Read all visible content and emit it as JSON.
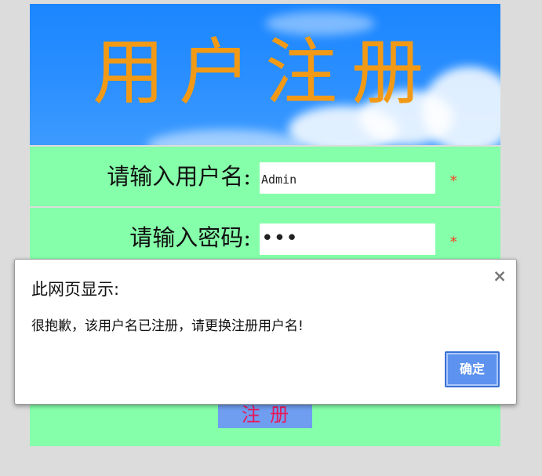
{
  "banner": {
    "title": "用户注册"
  },
  "form": {
    "username_label": "请输入用户名:",
    "username_value": "Admin",
    "password_label": "请输入密码:",
    "password_mask": "•••",
    "required_mark": "*",
    "submit_label": "注册"
  },
  "dialog": {
    "title": "此网页显示:",
    "close_symbol": "×",
    "message": "很抱歉，该用户名已注册，请更换注册用户名!",
    "ok_label": "确定"
  },
  "colors": {
    "banner_sky": "#1b86ff",
    "banner_title": "#f29a16",
    "form_background": "#85ffa9",
    "required_mark": "#ff3a1c",
    "submit_button": "#6f9df0",
    "submit_text": "#e8185a",
    "dialog_ok_button": "#5d93ee"
  }
}
